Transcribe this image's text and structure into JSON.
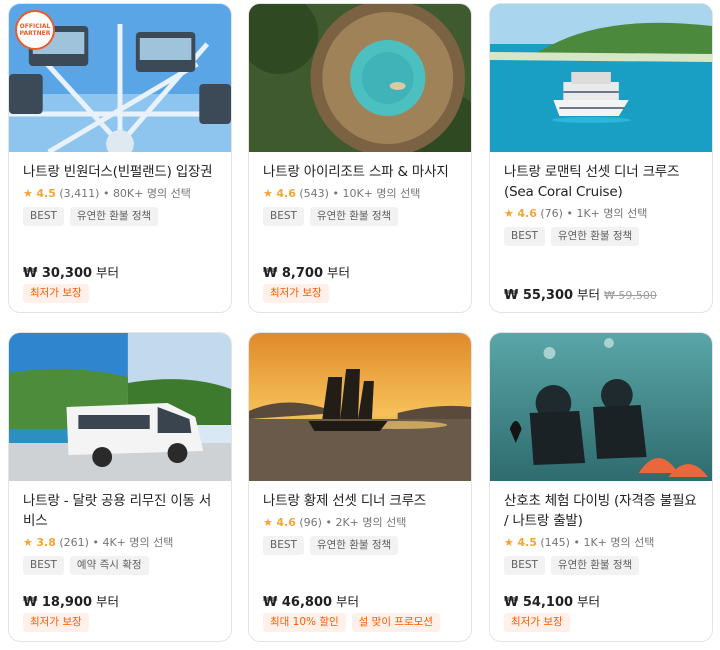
{
  "cards": [
    {
      "title": "나트랑 빈원더스(빈펄랜드) 입장권",
      "score": "4.5",
      "reviews": "(3,411)",
      "booked": "• 80K+ 명의 선택",
      "tags": [
        "BEST",
        "유연한 환불 정책"
      ],
      "price": "₩ 30,300",
      "price_suffix": "부터",
      "original_price": "",
      "promos": [
        "최저가 보장"
      ],
      "logo_text": "OFFICIAL PARTNER"
    },
    {
      "title": "나트랑 아이리조트 스파 & 마사지",
      "score": "4.6",
      "reviews": "(543)",
      "booked": "• 10K+ 명의 선택",
      "tags": [
        "BEST",
        "유연한 환불 정책"
      ],
      "price": "₩ 8,700",
      "price_suffix": "부터",
      "original_price": "",
      "promos": [
        "최저가 보장"
      ]
    },
    {
      "title": "나트랑 로맨틱 선셋 디너 크루즈 (Sea Coral Cruise)",
      "score": "4.6",
      "reviews": "(76)",
      "booked": "• 1K+ 명의 선택",
      "tags": [
        "BEST",
        "유연한 환불 정책"
      ],
      "price": "₩ 55,300",
      "price_suffix": "부터",
      "original_price": "₩ 59,500",
      "promos": []
    },
    {
      "title": "나트랑 - 달랏 공용 리무진 이동 서비스",
      "score": "3.8",
      "reviews": "(261)",
      "booked": "• 4K+ 명의 선택",
      "tags": [
        "BEST",
        "예약 즉시 확정"
      ],
      "price": "₩ 18,900",
      "price_suffix": "부터",
      "original_price": "",
      "promos": [
        "최저가 보장"
      ]
    },
    {
      "title": "나트랑 황제 선셋 디너 크루즈",
      "score": "4.6",
      "reviews": "(96)",
      "booked": "• 2K+ 명의 선택",
      "tags": [
        "BEST",
        "유연한 환불 정책"
      ],
      "price": "₩ 46,800",
      "price_suffix": "부터",
      "original_price": "",
      "promos": [
        "최대 10% 할인",
        "설 맞이 프로모션"
      ]
    },
    {
      "title": "산호초 체험 다이빙 (자격증 불필요 / 나트랑 출발)",
      "score": "4.5",
      "reviews": "(145)",
      "booked": "• 1K+ 명의 선택",
      "tags": [
        "BEST",
        "유연한 환불 정책"
      ],
      "price": "₩ 54,100",
      "price_suffix": "부터",
      "original_price": "",
      "promos": [
        "최저가 보장"
      ]
    }
  ],
  "colors": {
    "star": "#f4a534",
    "promo_text": "#ff5b00",
    "promo_bg": "#fff1ea",
    "tag_bg": "#f2f2f2"
  },
  "icons": {
    "rating": "star-icon"
  }
}
